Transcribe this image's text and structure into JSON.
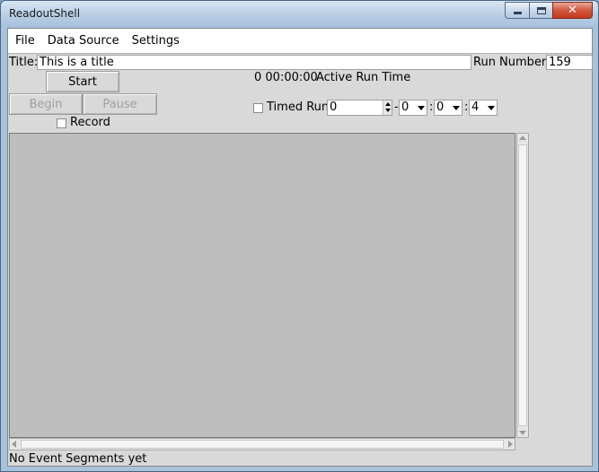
{
  "window": {
    "title": "ReadoutShell"
  },
  "menu": {
    "items": [
      "File",
      "Data Source",
      "Settings"
    ]
  },
  "title_field": {
    "label": "Title:",
    "value": "This is a title"
  },
  "run_number": {
    "label": "Run Number:",
    "value": "159"
  },
  "controls": {
    "start_label": "Start",
    "begin_label": "Begin",
    "pause_label": "Pause",
    "record_label": "Record",
    "record_checked": false
  },
  "run_time": {
    "value": "0 00:00:00",
    "label": "Active Run Time"
  },
  "timed_run": {
    "label": "Timed Run",
    "checked": false,
    "days": "0",
    "hours": "0",
    "minutes": "0",
    "seconds": "4",
    "sep_dash": "-",
    "sep_colon_1": ":",
    "sep_colon_2": ":"
  },
  "status": {
    "text": "No Event Segments yet"
  },
  "colors": {
    "canvas": "#bebebe",
    "client": "#d9d9d9",
    "close_button": "#c33a1e"
  }
}
